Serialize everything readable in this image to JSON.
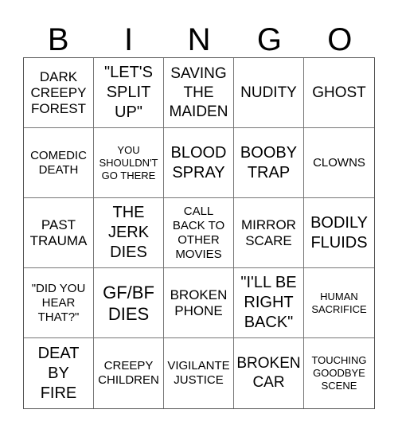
{
  "header": {
    "letters": [
      "B",
      "I",
      "N",
      "G",
      "O"
    ]
  },
  "cells": [
    "DARK\nCREEPY\nFOREST",
    "\"LET'S\nSPLIT\nUP\"",
    "SAVING\nTHE\nMAIDEN",
    "NUDITY",
    "GHOST",
    "COMEDIC\nDEATH",
    "YOU\nSHOULDN'T\nGO THERE",
    "BLOOD\nSPRAY",
    "BOOBY\nTRAP",
    "CLOWNS",
    "PAST\nTRAUMA",
    "THE\nJERK\nDIES",
    "CALL\nBACK TO\nOTHER\nMOVIES",
    "MIRROR\nSCARE",
    "BODILY\nFLUIDS",
    "\"DID YOU\nHEAR\nTHAT?\"",
    "GF/BF\nDIES",
    "BROKEN\nPHONE",
    "\"I'LL BE\nRIGHT\nBACK\"",
    "HUMAN\nSACRIFICE",
    "DEAT\nBY\nFIRE",
    "CREEPY\nCHILDREN",
    "VIGILANTE\nJUSTICE",
    "BROKEN\nCAR",
    "TOUCHING\nGOODBYE\nSCENE"
  ]
}
